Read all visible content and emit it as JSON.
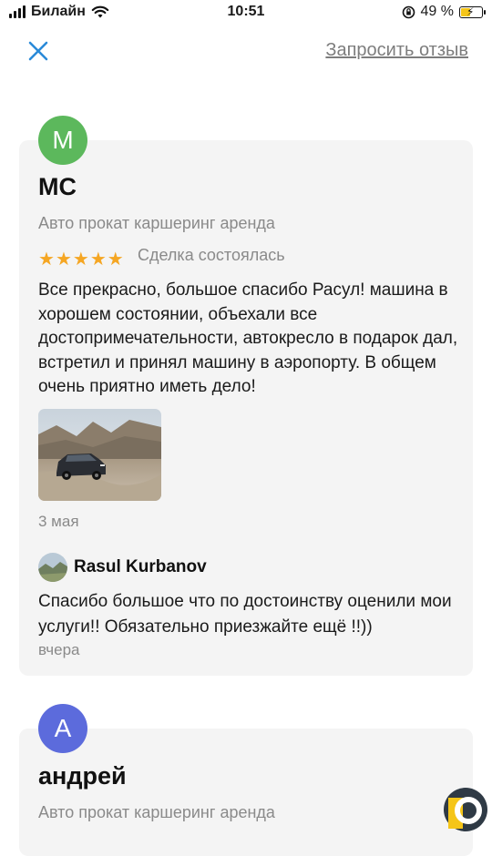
{
  "status_bar": {
    "carrier": "Билайн",
    "time": "10:51",
    "battery_percent": "49 %",
    "battery_level": 0.49
  },
  "header": {
    "close_icon": "close-icon",
    "request_review_label": "Запросить отзыв",
    "accent_color": "#2a8ad8"
  },
  "reviews": [
    {
      "avatar_letter": "M",
      "avatar_color": "#5cb85c",
      "author": "МС",
      "category": "Авто прокат каршеринг аренда",
      "rating": 5,
      "deal_status": "Сделка состоялась",
      "text": "Все прекрасно, большое спасибо Расул! машина в хорошем состоянии, объехали все достопримечательности, автокресло в подарок дал, встретил и принял машину в аэропорту. В общем очень приятно иметь дело!",
      "photo_icon": "car-photo",
      "date": "3 мая",
      "reply": {
        "author": "Rasul Kurbanov",
        "text": "Спасибо большое что по достоинству оценили мои услуги!! Обязательно приезжайте ещё !!))",
        "date": "вчера"
      }
    },
    {
      "avatar_letter": "А",
      "avatar_color": "#5c6bdc",
      "author": "андрей",
      "category": "Авто прокат каршеринг аренда"
    }
  ],
  "star_color": "#f5a623"
}
